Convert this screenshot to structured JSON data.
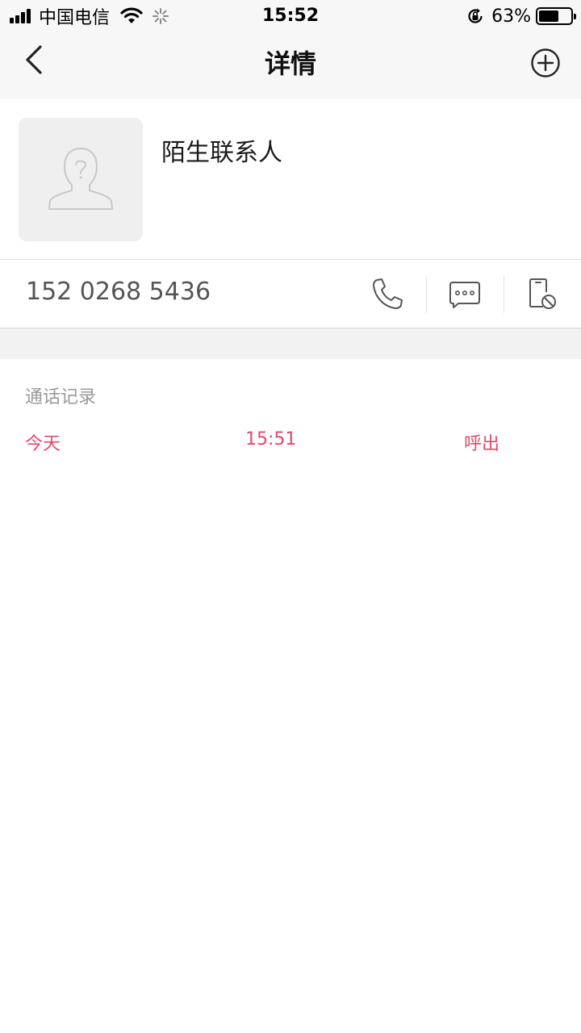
{
  "status_bar": {
    "carrier": "中国电信",
    "time": "15:52",
    "battery_percent": "63%",
    "battery_level": 0.63,
    "icons": [
      "signal-icon",
      "wifi-icon",
      "loading-icon",
      "rotation-lock-icon",
      "battery-icon"
    ]
  },
  "nav": {
    "title": "详情",
    "back_icon": "chevron-left-icon",
    "add_icon": "plus-circle-icon"
  },
  "contact": {
    "name": "陌生联系人",
    "avatar_icon": "unknown-person-icon"
  },
  "phone": {
    "number": "152 0268 5436",
    "actions": [
      {
        "icon": "phone-icon"
      },
      {
        "icon": "message-icon"
      },
      {
        "icon": "block-phone-icon"
      }
    ]
  },
  "call_log": {
    "title": "通话记录",
    "entries": [
      {
        "day": "今天",
        "time": "15:51",
        "type": "呼出"
      }
    ]
  },
  "colors": {
    "accent": "#e4486a",
    "bar_background": "#f7f7f7",
    "band": "#f2f2f2"
  }
}
